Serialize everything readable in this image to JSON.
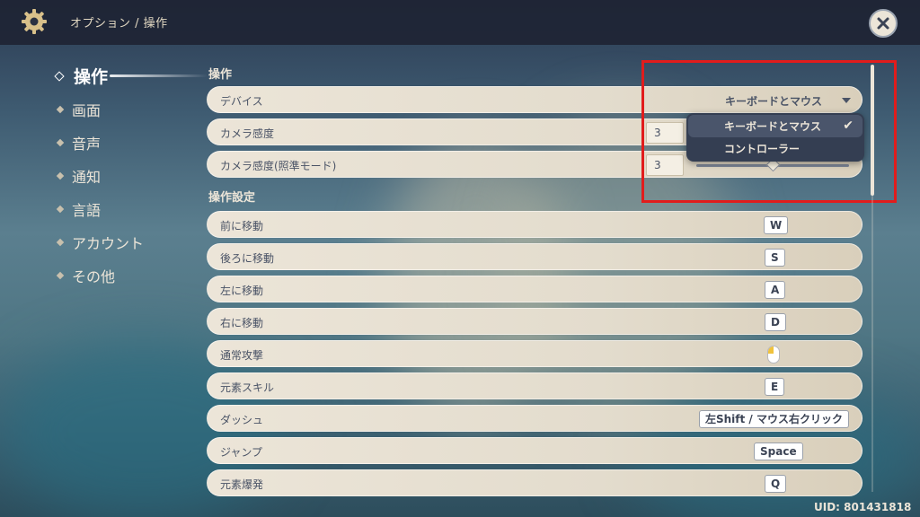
{
  "breadcrumb": "オプション / 操作",
  "sidebar": {
    "items": [
      {
        "label": "操作",
        "active": true
      },
      {
        "label": "画面"
      },
      {
        "label": "音声"
      },
      {
        "label": "通知"
      },
      {
        "label": "言語"
      },
      {
        "label": "アカウント"
      },
      {
        "label": "その他"
      }
    ]
  },
  "sections": {
    "controls_title": "操作",
    "keybind_title": "操作設定"
  },
  "device": {
    "label": "デバイス",
    "value": "キーボードとマウス",
    "options": [
      "キーボードとマウス",
      "コントローラー"
    ],
    "selected_option": "キーボードとマウス"
  },
  "camera": {
    "sensitivity_label": "カメラ感度",
    "sensitivity_value": "3",
    "aim_label": "カメラ感度(照準モード)",
    "aim_value": "3"
  },
  "keybinds": [
    {
      "label": "前に移動",
      "key": "W"
    },
    {
      "label": "後ろに移動",
      "key": "S"
    },
    {
      "label": "左に移動",
      "key": "A"
    },
    {
      "label": "右に移動",
      "key": "D"
    },
    {
      "label": "通常攻撃",
      "key": "",
      "icon": "mouse-left-click-icon"
    },
    {
      "label": "元素スキル",
      "key": "E"
    },
    {
      "label": "ダッシュ",
      "key": "左Shift / マウス右クリック"
    },
    {
      "label": "ジャンプ",
      "key": "Space"
    },
    {
      "label": "元素爆発",
      "key": "Q"
    }
  ],
  "uid": "UID: 801431818",
  "colors": {
    "highlight": "#e11c1c",
    "row_bg": "#ece5d8",
    "topbar": "#1e2434",
    "dropdown": "#343e52"
  }
}
